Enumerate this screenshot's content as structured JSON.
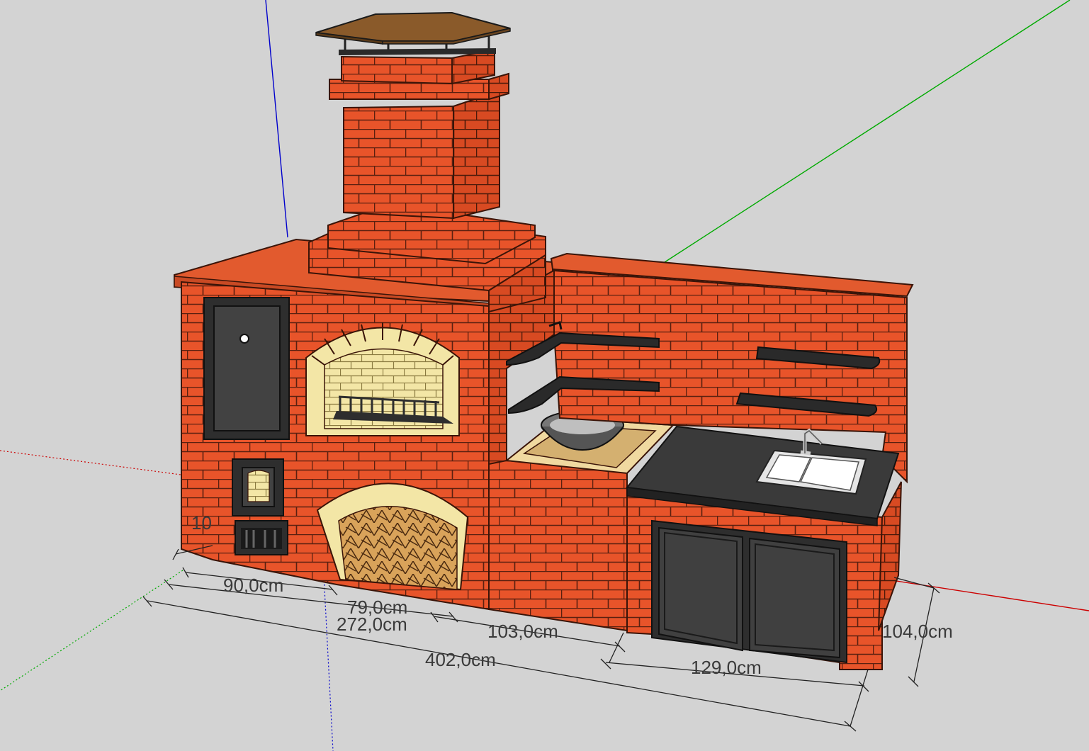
{
  "viewport": {
    "background": "#d3d3d3",
    "axes": {
      "x_axis_color": "#cc0000",
      "y_axis_color": "#00aa00",
      "z_axis_color": "#0000cc"
    }
  },
  "model": {
    "brick_color": "#e8542a",
    "mortar_color": "#5a2010",
    "firebrick_color": "#f3e6a6",
    "metal_color": "#3c3c3c",
    "countertop_color": "#3a3a3a",
    "roof_color": "#8a5a2a"
  },
  "dimensions": {
    "partial_left": "10",
    "section_90": "90,0cm",
    "section_79": "79,0cm",
    "total_272": "272,0cm",
    "section_103": "103,0cm",
    "total_402": "402,0cm",
    "section_129": "129,0cm",
    "depth_104": "104,0cm"
  }
}
